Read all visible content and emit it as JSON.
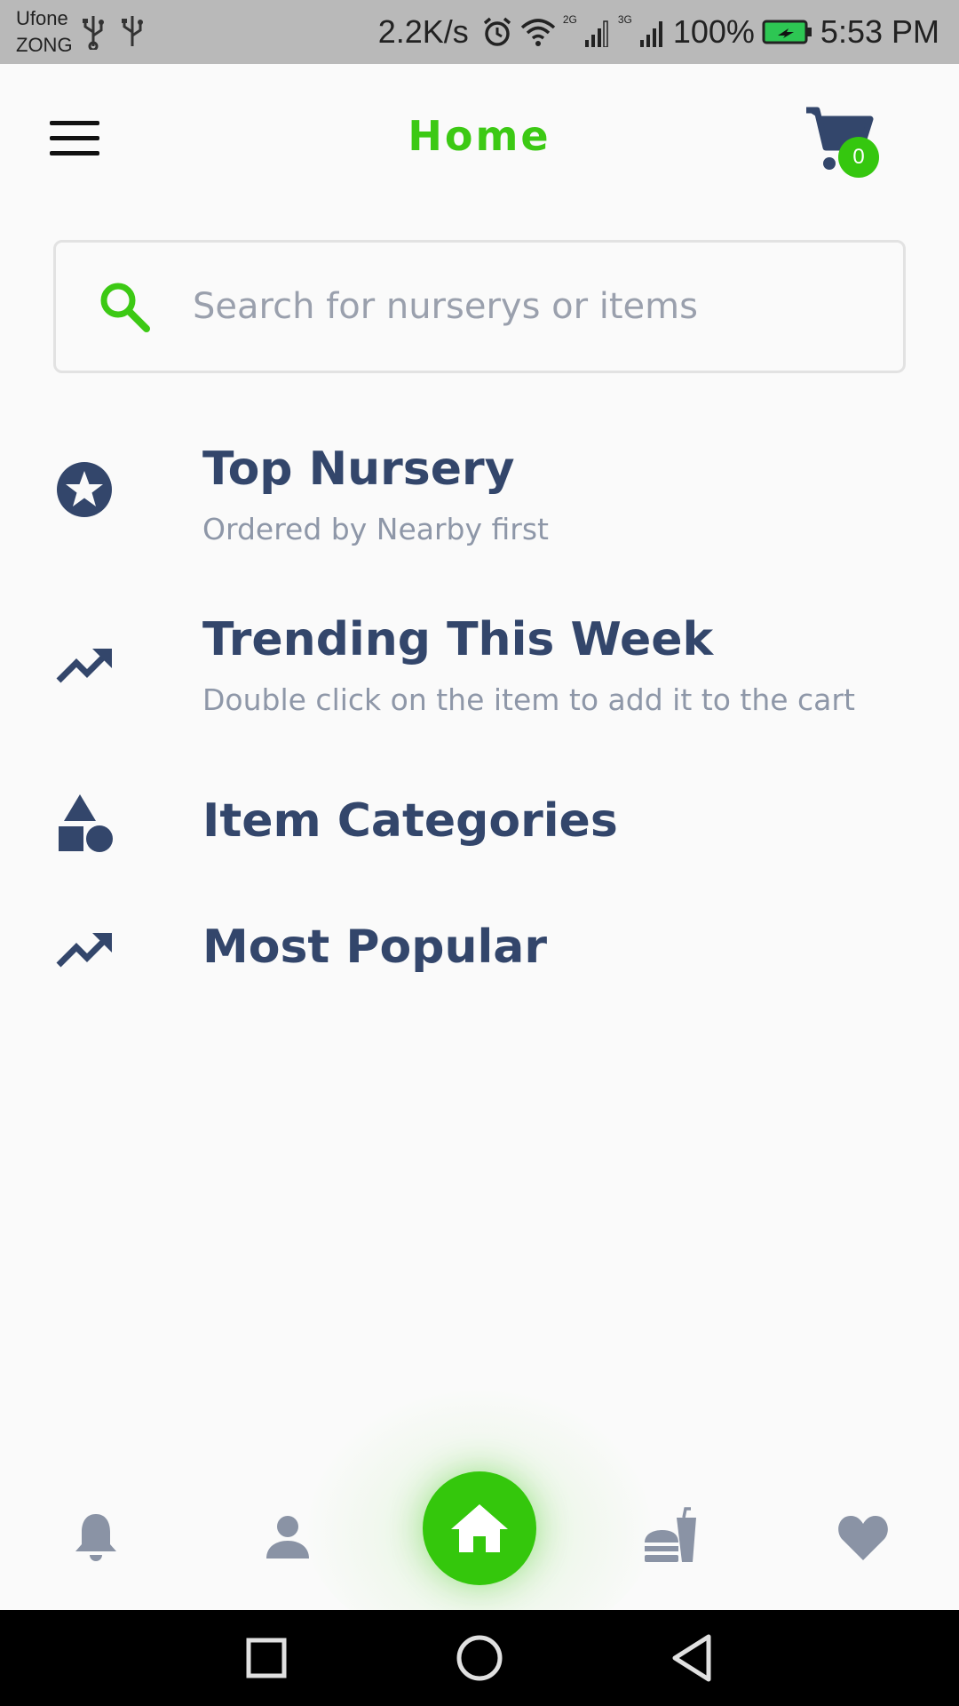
{
  "status_bar": {
    "carrier1": "Ufone",
    "carrier2": "ZONG",
    "net_speed": "2.2K/s",
    "net_type1": "2G",
    "net_type2": "3G",
    "battery": "100%",
    "time": "5:53 PM"
  },
  "header": {
    "title": "Home",
    "cart_count": "0"
  },
  "search": {
    "placeholder": "Search for nurserys or items"
  },
  "sections": {
    "top_nursery": {
      "title": "Top Nursery",
      "subtitle": "Ordered by Nearby first"
    },
    "trending": {
      "title": "Trending This Week",
      "subtitle": "Double click on the item to add it to the cart"
    },
    "categories": {
      "title": "Item Categories"
    },
    "popular": {
      "title": "Most Popular"
    }
  },
  "colors": {
    "accent": "#3cc914",
    "text_primary": "#33466b",
    "text_secondary": "#8e97a8",
    "nav_icon": "#8a93a5"
  },
  "bottom_nav": {
    "items": [
      "bell-icon",
      "person-icon",
      "home-icon",
      "fastfood-icon",
      "heart-icon"
    ],
    "active": "home-icon"
  }
}
